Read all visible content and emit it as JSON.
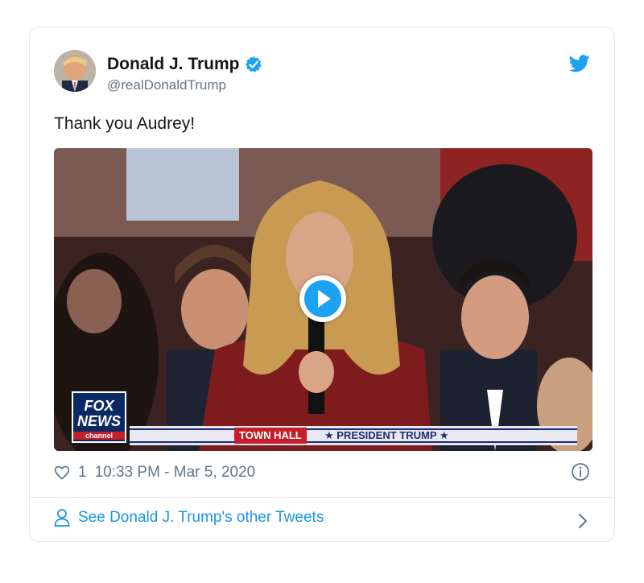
{
  "tweet": {
    "display_name": "Donald J. Trump",
    "handle": "@realDonaldTrump",
    "text": "Thank you Audrey!",
    "likes": "1",
    "timestamp": "10:33 PM - Mar 5, 2020"
  },
  "media": {
    "channel_logo_line1": "FOX",
    "channel_logo_line2": "NEWS",
    "channel_logo_line3": "channel",
    "ticker_segment": "TOWN HALL",
    "ticker_program": "★ PRESIDENT TRUMP ★"
  },
  "footer": {
    "more_tweets_label": "See Donald J. Trump's other Tweets"
  },
  "colors": {
    "link_blue": "#1b95e0",
    "twitter_blue": "#1da1f2",
    "muted_gray": "#657786",
    "border": "#e1e8ed"
  },
  "icons": [
    "verified-badge-icon",
    "twitter-bird-icon",
    "play-icon",
    "heart-icon",
    "info-icon",
    "person-icon",
    "chevron-right-icon"
  ]
}
